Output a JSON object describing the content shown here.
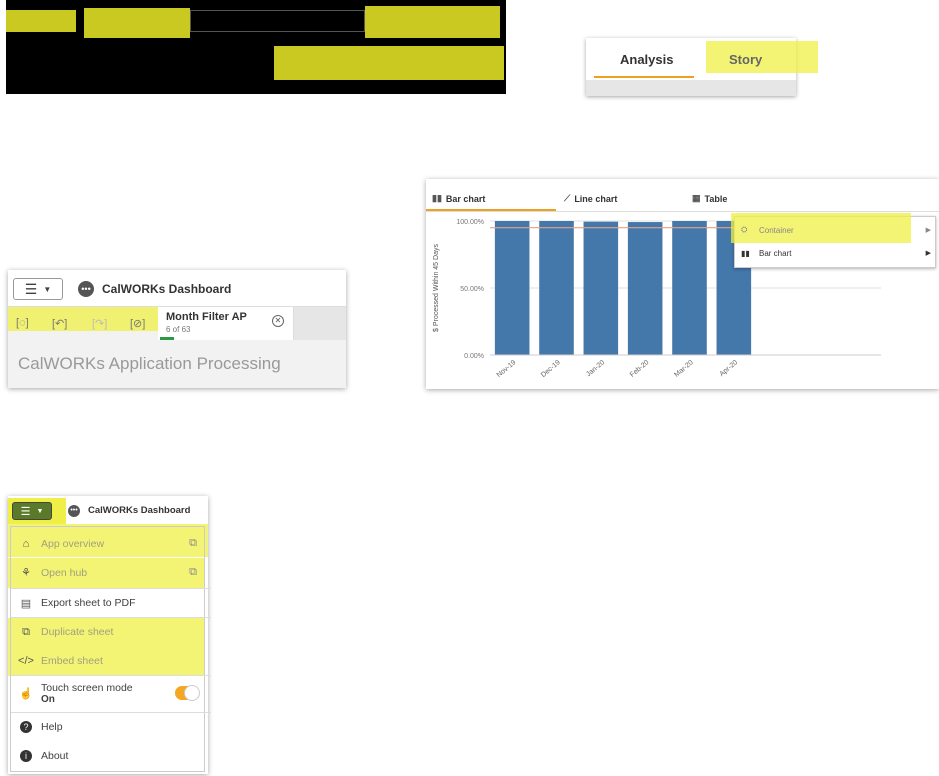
{
  "tabs": {
    "analysis": "Analysis",
    "story": "Story"
  },
  "app": {
    "title": "CalWORKs Dashboard",
    "filter": {
      "title": "Month Filter AP",
      "count": "6 of 63"
    },
    "sheet_title": "CalWORKs Application Processing"
  },
  "chart_tabs": {
    "bar": "Bar chart",
    "line": "Line chart",
    "table": "Table"
  },
  "context_menu": {
    "container": "Container",
    "bar_chart": "Bar chart"
  },
  "chart_data": {
    "type": "bar",
    "categories": [
      "Nov-19",
      "Dec-19",
      "Jan-20",
      "Feb-20",
      "Mar-20",
      "Apr-20"
    ],
    "values": [
      100,
      100,
      99.5,
      99.2,
      100,
      100
    ],
    "ylabel": "$ Processed Within 45 Days",
    "ylim": [
      0,
      100
    ],
    "ytick_labels": [
      "0.00%",
      "50.00%",
      "100.00%"
    ],
    "ytick_values": [
      0,
      50,
      100
    ],
    "reference_line": 95,
    "colors": {
      "bar": "#4477aa",
      "reference": "#e8a088"
    }
  },
  "menu": {
    "app_title": "CalWORKs Dashboard",
    "items": [
      {
        "label": "App overview",
        "icon": "home-icon"
      },
      {
        "label": "Open hub",
        "icon": "hub-icon"
      },
      {
        "label": "Export sheet to PDF",
        "icon": "printer-icon"
      },
      {
        "label": "Duplicate sheet",
        "icon": "duplicate-icon"
      },
      {
        "label": "Embed sheet",
        "icon": "code-icon"
      },
      {
        "label": "Touch screen mode",
        "icon": "touch-icon",
        "sub": "On"
      },
      {
        "label": "Help",
        "icon": "help-icon"
      },
      {
        "label": "About",
        "icon": "info-icon"
      }
    ]
  },
  "colors": {
    "highlight": "#ecec28",
    "accent_orange": "#f0a020",
    "bar_blue": "#4477aa",
    "toggle_orange": "#f5a623"
  }
}
